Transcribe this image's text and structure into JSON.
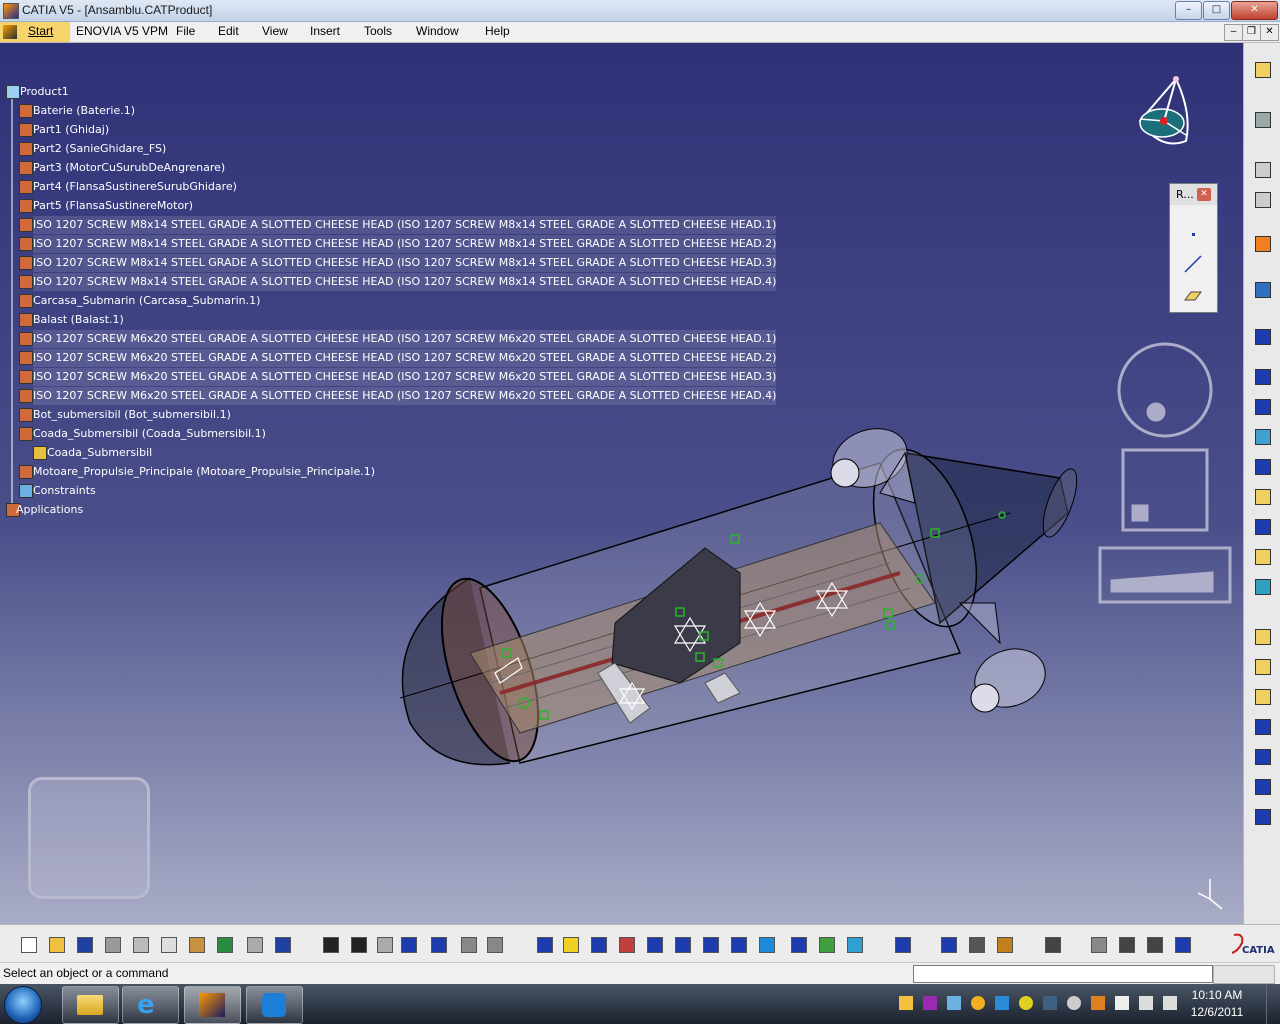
{
  "window": {
    "title": "CATIA V5 - [Ansamblu.CATProduct]",
    "min_icon": "minimize-icon",
    "max_icon": "maximize-icon",
    "close_icon": "close-icon"
  },
  "menu": {
    "start": "Start",
    "items": [
      "ENOVIA V5 VPM",
      "File",
      "Edit",
      "View",
      "Insert",
      "Tools",
      "Window",
      "Help"
    ]
  },
  "tree": {
    "root": "Product1",
    "items": [
      "Baterie (Baterie.1)",
      "Part1 (Ghidaj)",
      "Part2 (SanieGhidare_FS)",
      "Part3 (MotorCuSurubDeAngrenare)",
      "Part4 (FlansaSustinereSurubGhidare)",
      "Part5 (FlansaSustinereMotor)",
      "ISO 1207 SCREW M8x14 STEEL GRADE A SLOTTED CHEESE HEAD (ISO 1207 SCREW M8x14 STEEL GRADE A SLOTTED CHEESE HEAD.1)",
      "ISO 1207 SCREW M8x14 STEEL GRADE A SLOTTED CHEESE HEAD (ISO 1207 SCREW M8x14 STEEL GRADE A SLOTTED CHEESE HEAD.2)",
      "ISO 1207 SCREW M8x14 STEEL GRADE A SLOTTED CHEESE HEAD (ISO 1207 SCREW M8x14 STEEL GRADE A SLOTTED CHEESE HEAD.3)",
      "ISO 1207 SCREW M8x14 STEEL GRADE A SLOTTED CHEESE HEAD (ISO 1207 SCREW M8x14 STEEL GRADE A SLOTTED CHEESE HEAD.4)",
      "Carcasa_Submarin (Carcasa_Submarin.1)",
      "Balast (Balast.1)",
      "ISO 1207 SCREW M6x20 STEEL GRADE A SLOTTED CHEESE HEAD (ISO 1207 SCREW M6x20 STEEL GRADE A SLOTTED CHEESE HEAD.1)",
      "ISO 1207 SCREW M6x20 STEEL GRADE A SLOTTED CHEESE HEAD (ISO 1207 SCREW M6x20 STEEL GRADE A SLOTTED CHEESE HEAD.2)",
      "ISO 1207 SCREW M6x20 STEEL GRADE A SLOTTED CHEESE HEAD (ISO 1207 SCREW M6x20 STEEL GRADE A SLOTTED CHEESE HEAD.3)",
      "ISO 1207 SCREW M6x20 STEEL GRADE A SLOTTED CHEESE HEAD (ISO 1207 SCREW M6x20 STEEL GRADE A SLOTTED CHEESE HEAD.4)",
      "Bot_submersibil (Bot_submersibil.1)",
      "Coada_Submersibil (Coada_Submersibil.1)"
    ],
    "child": "Coada_Submersibil",
    "after": [
      "Motoare_Propulsie_Principale (Motoare_Propulsie_Principale.1)",
      "Constraints",
      "Applications"
    ]
  },
  "rpanel": {
    "title": "R..."
  },
  "status": {
    "message": "Select an object or a command"
  },
  "clock": {
    "time": "10:10 AM",
    "date": "12/6/2011"
  },
  "brand": {
    "logo_text": "CATIA"
  },
  "colors": {
    "viewport_top": "#2f3177",
    "viewport_bottom": "#a9acc6",
    "selection": "#f6d36c",
    "constraint_green": "#2db32d"
  }
}
